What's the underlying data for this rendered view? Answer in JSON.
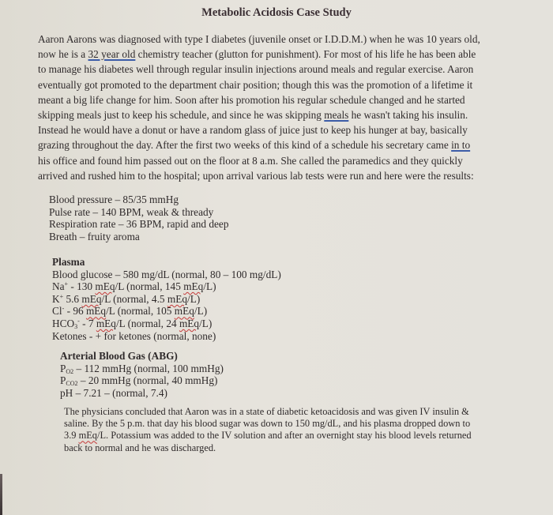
{
  "document": {
    "title": "Metabolic Acidosis Case Study",
    "intro_lines": [
      {
        "pre": "Aaron Aarons was diagnosed with type I diabetes (juvenile onset or I.D.D.M.) when he was 10 years old,"
      },
      {
        "pre": "now he is a ",
        "mark": "32 year old",
        "post": " chemistry teacher (glutton for punishment). For most of his life he has been able"
      },
      {
        "pre": "to manage his diabetes well through regular insulin injections around meals and regular exercise. Aaron"
      },
      {
        "pre": "eventually got promoted to the department chair position; though this was the promotion of a lifetime it"
      },
      {
        "pre": "meant a big life change for him. Soon after his promotion his regular schedule changed and he started"
      },
      {
        "pre": "skipping meals just to keep his schedule, and since he was skipping ",
        "mark": "meals",
        "post": " he wasn't taking his insulin."
      },
      {
        "pre": "Instead he would have a donut or have a random glass of juice just to keep his hunger at bay, basically"
      },
      {
        "pre": "grazing throughout the day. After the first two weeks of this kind of a schedule his secretary came ",
        "mark": "in to",
        "post": ""
      },
      {
        "pre": "his office and found him passed out on the floor at 8 a.m. She called the paramedics and they quickly"
      },
      {
        "pre": "arrived and rushed him to the hospital; upon arrival various lab tests were run and here were the results:"
      }
    ],
    "vitals": [
      "Blood pressure – 85/35 mmHg",
      "Pulse rate – 140 BPM, weak & thready",
      "Respiration rate – 36 BPM, rapid and deep",
      "Breath – fruity aroma"
    ],
    "plasma": {
      "heading": "Plasma",
      "glucose": "Blood glucose – 580 mg/dL (normal, 80 – 100 mg/dL)",
      "na": {
        "symbol": "Na",
        "charge": "+",
        "value": " - 130 ",
        "unit": "mEq",
        "rest1": "/L (normal, 145 ",
        "rest2": "/L)"
      },
      "k": {
        "symbol": "K",
        "charge": "+",
        "value": " 5.6 ",
        "unit": "mEq",
        "rest1": "/L (normal, 4.5 ",
        "rest2": "/L)"
      },
      "cl": {
        "symbol": "Cl",
        "charge": "-",
        "value": " - 96 ",
        "unit": "mEq",
        "rest1": "/L (normal, 105 ",
        "rest2": "/L)"
      },
      "hco3": {
        "symbol": "HCO",
        "sub": "3",
        "charge": "-",
        "value": " - 7 ",
        "unit": "mEq",
        "rest1": "/L (normal, 24 ",
        "rest2": "/L)"
      },
      "ketones": "Ketones - + for ketones (normal, none)"
    },
    "abg": {
      "heading": "Arterial Blood Gas (ABG)",
      "po2": {
        "symbol": "P",
        "sub": "O2",
        "text": " – 112 mmHg (normal, 100 mmHg)"
      },
      "pco2": {
        "symbol": "P",
        "sub": "CO2",
        "text": " – 20 mmHg (normal, 40 mmHg)"
      },
      "ph": "pH – 7.21 – (normal, 7.4)"
    },
    "conclusion": {
      "line1": "The physicians concluded that Aaron was in a state of diabetic ketoacidosis and was given IV insulin &",
      "line2": "saline. By the 5 p.m. that day his blood sugar was down to 150 mg/dL, and his plasma dropped down to",
      "line3_pre": "3.9 ",
      "line3_mark": "mEq",
      "line3_post": "/L. Potassium was added to the IV solution and after an overnight stay his blood levels returned",
      "line4": "back to normal and he was discharged."
    }
  },
  "colors": {
    "background": "#e3e0d8",
    "text": "#2f2a2b",
    "spellcheck_grammar": "#3d5da8",
    "spellcheck_spelling": "#c43a3a"
  }
}
